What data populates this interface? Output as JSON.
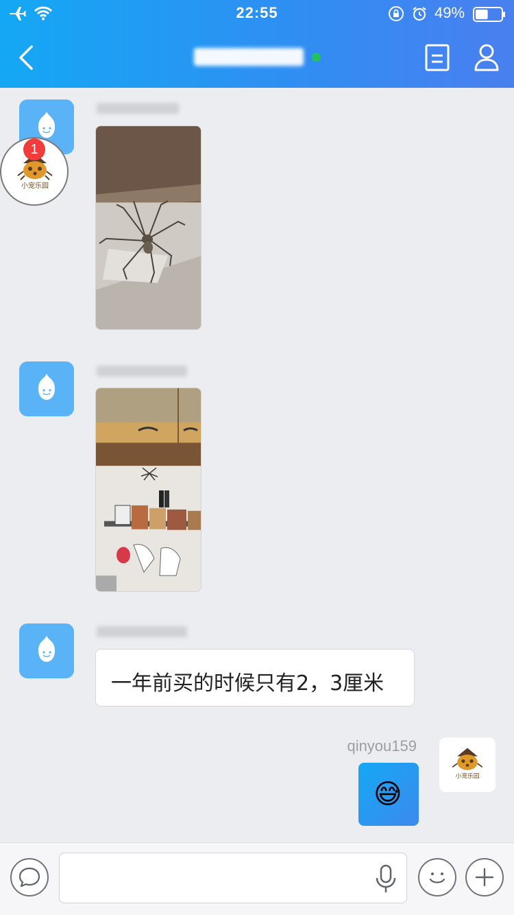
{
  "status_bar": {
    "time": "22:55",
    "battery_percent": "49%",
    "battery_level": 0.49,
    "icons": [
      "airplane-icon",
      "wifi-icon",
      "rotation-lock-icon",
      "alarm-icon",
      "battery-icon"
    ]
  },
  "header": {
    "back_icon": "chevron-left-icon",
    "contact_name_redacted": true,
    "online": true,
    "online_color": "#22c35a",
    "right_icons": [
      "document-icon",
      "person-icon"
    ],
    "gradient": [
      "#14a8f4",
      "#4a7ff0"
    ]
  },
  "floating_badge": {
    "count": "1",
    "logo_text": "小宠乐园"
  },
  "messages": [
    {
      "side": "left",
      "type": "photo",
      "avatar_icon": "qq-penguin-icon",
      "sender_redacted": true,
      "content": "spider on wall photo"
    },
    {
      "side": "left",
      "type": "photo",
      "avatar_icon": "qq-penguin-icon",
      "sender_redacted": true,
      "content": "spider above kitchen shelf photo"
    },
    {
      "side": "left",
      "type": "text",
      "avatar_icon": "qq-penguin-icon",
      "sender_redacted": true,
      "text": "一年前买的时候只有2，3厘米"
    },
    {
      "side": "right",
      "type": "emoji",
      "sender": "qinyou159",
      "emoji": "😅",
      "avatar_text": "小宠乐园"
    }
  ],
  "input_bar": {
    "placeholder": "",
    "value": "",
    "icons": [
      "chat-bubble-icon",
      "microphone-icon",
      "smiley-icon",
      "plus-icon"
    ]
  },
  "colors": {
    "background": "#ebedf1",
    "qq_avatar": "#5ab2f7",
    "badge": "#f23c3c"
  }
}
